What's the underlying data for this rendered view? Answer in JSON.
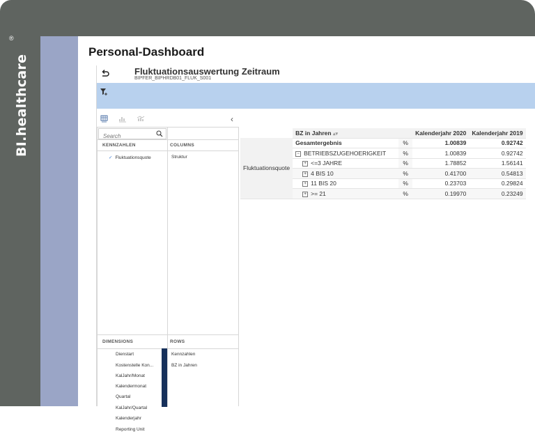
{
  "brand": {
    "name": "BI.healthcare",
    "reg_mark": "®"
  },
  "page_title": "Personal-Dashboard",
  "report": {
    "title": "Fluktuationsauswertung Zeitraum",
    "subtitle": "BIPFER_BIPHRDB01_FLUK_S001"
  },
  "search": {
    "placeholder": "Search"
  },
  "sections": {
    "kennzahlen": "KENNZAHLEN",
    "columns": "COLUMNS",
    "dimensions": "DIMENSIONS",
    "rows": "ROWS"
  },
  "kennzahlen_items": [
    {
      "check": "✓",
      "label": "Fluktuationsquote"
    }
  ],
  "columns_items": [
    "Struktur"
  ],
  "dimensions_items": [
    "Dienstart",
    "Kostenstelle Kon...",
    "KalJahr/Monat",
    "Kalendermonat",
    "Quartal",
    "KalJahr/Quartal",
    "Kalenderjahr",
    "Reporting Unit"
  ],
  "rows_items": [
    "Kennzahlen",
    "BZ in Jahren"
  ],
  "table": {
    "row_label": "Fluktuationsquote",
    "header": {
      "dim": "BZ in Jahren",
      "col1": "Kalenderjahr 2020",
      "col2": "Kalenderjahr 2019"
    },
    "rows": [
      {
        "label": "Gesamtergebnis",
        "unit": "%",
        "v1": "1.00839",
        "v2": "0.92742"
      },
      {
        "label": "BETRIEBSZUGEHOERIGKEIT",
        "unit": "%",
        "v1": "1.00839",
        "v2": "0.92742"
      },
      {
        "label": "<=3 JAHRE",
        "unit": "%",
        "v1": "1.78852",
        "v2": "1.56141"
      },
      {
        "label": "4 BIS 10",
        "unit": "%",
        "v1": "0.41700",
        "v2": "0.54813"
      },
      {
        "label": "11 BIS 20",
        "unit": "%",
        "v1": "0.23703",
        "v2": "0.29824"
      },
      {
        "label": ">= 21",
        "unit": "%",
        "v1": "0.19970",
        "v2": "0.23249"
      }
    ]
  },
  "icons": {
    "back": "back-arrow-icon",
    "filter": "filter-add-icon",
    "search": "search-icon",
    "collapse": "chevron-left-icon"
  },
  "colors": {
    "frame": "#5f6460",
    "brand_strip": "#9aa5c6",
    "filterbar": "#b8d1ee",
    "dimension_bar": "#16305a"
  }
}
